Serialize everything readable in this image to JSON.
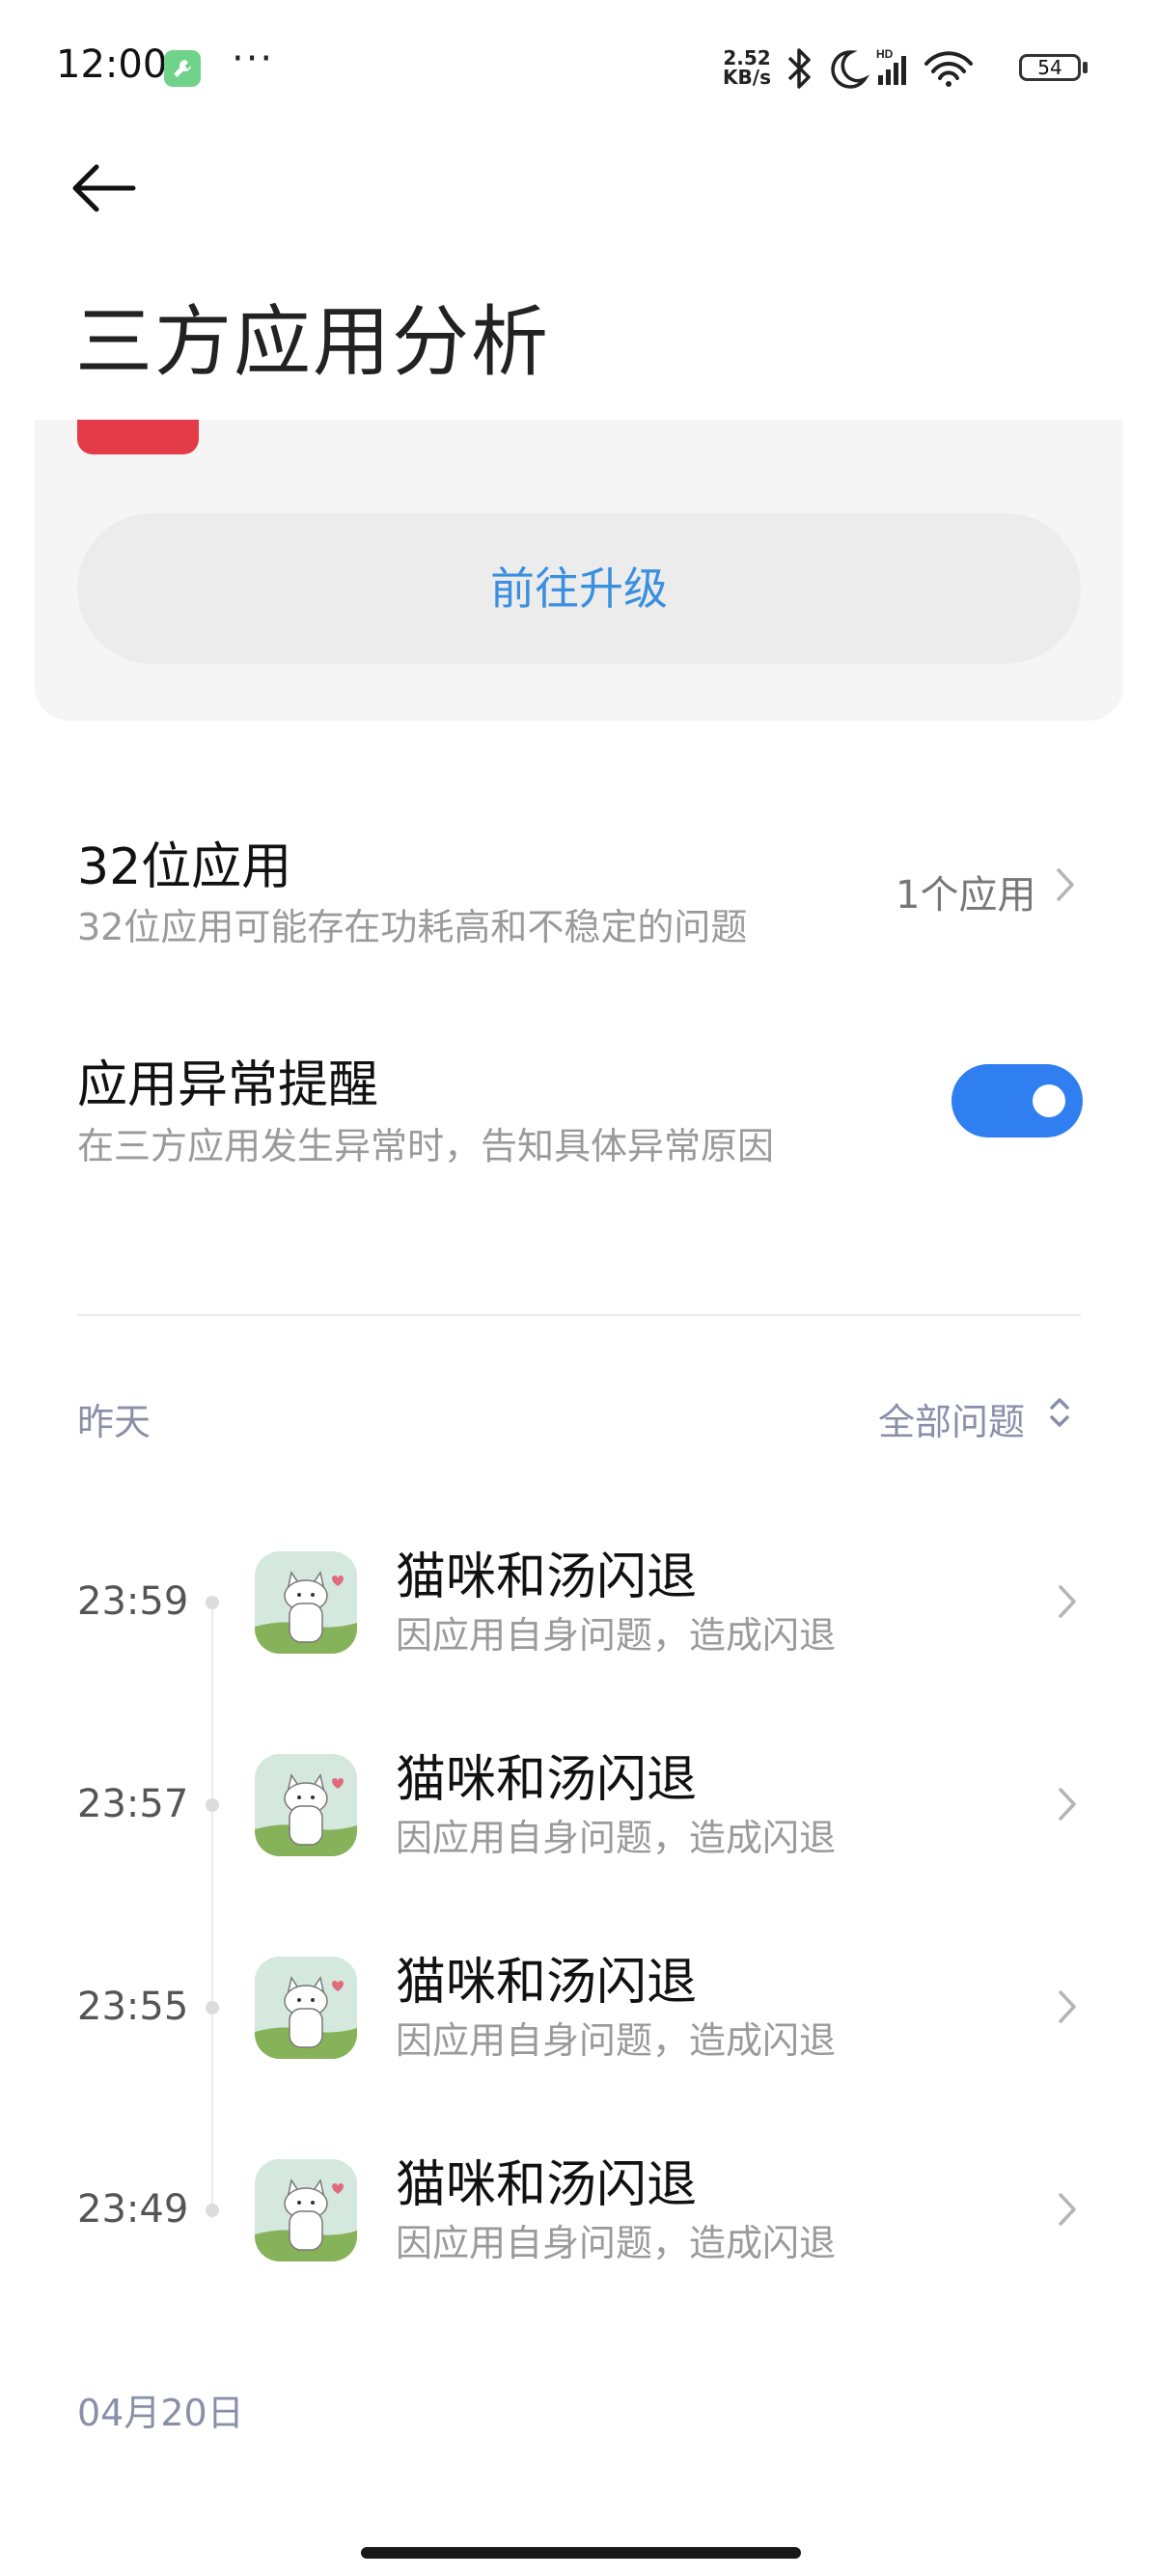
{
  "status_bar": {
    "time": "12:00",
    "dots": "···",
    "net_speed_value": "2.52",
    "net_speed_unit": "KB/s",
    "battery": "54"
  },
  "header": {
    "title": "三方应用分析"
  },
  "upgrade": {
    "label": "前往升级"
  },
  "settings": {
    "bit32": {
      "title": "32位应用",
      "subtitle": "32位应用可能存在功耗高和不稳定的问题",
      "value": "1个应用"
    },
    "alert": {
      "title": "应用异常提醒",
      "subtitle": "在三方应用发生异常时，告知具体异常原因",
      "enabled": true
    }
  },
  "timeline": {
    "section_label": "昨天",
    "filter_label": "全部问题",
    "items": [
      {
        "time": "23:59",
        "title": "猫咪和汤闪退",
        "subtitle": "因应用自身问题，造成闪退"
      },
      {
        "time": "23:57",
        "title": "猫咪和汤闪退",
        "subtitle": "因应用自身问题，造成闪退"
      },
      {
        "time": "23:55",
        "title": "猫咪和汤闪退",
        "subtitle": "因应用自身问题，造成闪退"
      },
      {
        "time": "23:49",
        "title": "猫咪和汤闪退",
        "subtitle": "因应用自身问题，造成闪退"
      }
    ],
    "next_section_label": "04月20日"
  },
  "colors": {
    "accent_blue": "#2f7ff0",
    "link_blue": "#3a8fe0",
    "badge_red": "#e33b48"
  }
}
